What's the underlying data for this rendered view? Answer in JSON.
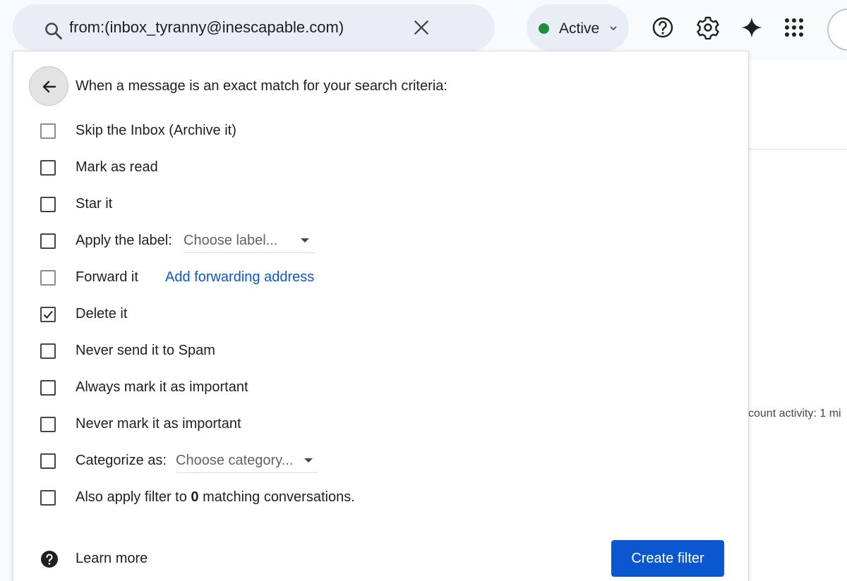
{
  "search": {
    "query": "from:(inbox_tyranny@inescapable.com)"
  },
  "status": {
    "label": "Active",
    "color": "#1e8e3e"
  },
  "icons": [
    "search-icon",
    "clear-icon",
    "help-icon",
    "settings-icon",
    "sparkle-icon",
    "apps-icon",
    "back-arrow-icon",
    "chevron-down-icon"
  ],
  "background": {
    "account_activity": "count activity: 1 mi"
  },
  "filter_dialog": {
    "heading": "When a message is an exact match for your search criteria:",
    "options": [
      {
        "label": "Skip the Inbox (Archive it)",
        "checked": false
      },
      {
        "label": "Mark as read",
        "checked": false
      },
      {
        "label": "Star it",
        "checked": false
      },
      {
        "label": "Apply the label:",
        "checked": false,
        "dropdown": "Choose label..."
      },
      {
        "label": "Forward it",
        "checked": false,
        "link": "Add forwarding address"
      },
      {
        "label": "Delete it",
        "checked": true
      },
      {
        "label": "Never send it to Spam",
        "checked": false
      },
      {
        "label": "Always mark it as important",
        "checked": false
      },
      {
        "label": "Never mark it as important",
        "checked": false
      },
      {
        "label": "Categorize as:",
        "checked": false,
        "dropdown": "Choose category..."
      },
      {
        "label_prefix": "Also apply filter to ",
        "count": "0",
        "label_suffix": " matching conversations.",
        "checked": false
      }
    ],
    "learn_more": "Learn more",
    "create_filter": "Create filter",
    "accent_color": "#0b57d0"
  }
}
